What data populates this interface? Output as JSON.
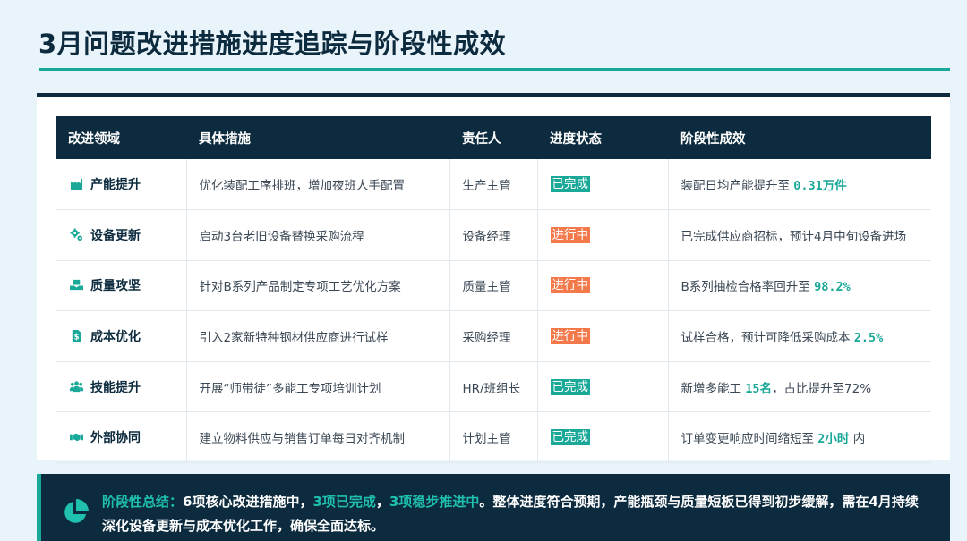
{
  "page": {
    "title": "3月问题改进措施进度追踪与阶段性成效"
  },
  "table": {
    "headers": [
      "改进领域",
      "具体措施",
      "责任人",
      "进度状态",
      "阶段性成效"
    ],
    "rows": [
      {
        "area": "产能提升",
        "icon": "factory-icon",
        "measure": "优化装配工序排班，增加夜班人手配置",
        "owner": "生产主管",
        "status": "已完成",
        "status_type": "done",
        "result_pre": "装配日均产能提升至 ",
        "result_hl": "0.31万件",
        "result_post": ""
      },
      {
        "area": "设备更新",
        "icon": "gears-icon",
        "measure": "启动3台老旧设备替换采购流程",
        "owner": "设备经理",
        "status": "进行中",
        "status_type": "doing",
        "result_pre": "已完成供应商招标，预计4月中旬设备进场",
        "result_hl": "",
        "result_post": ""
      },
      {
        "area": "质量攻坚",
        "icon": "hands-box-icon",
        "measure": "针对B系列产品制定专项工艺优化方案",
        "owner": "质量主管",
        "status": "进行中",
        "status_type": "doing",
        "result_pre": "B系列抽检合格率回升至 ",
        "result_hl": "98.2%",
        "result_post": ""
      },
      {
        "area": "成本优化",
        "icon": "dollar-file-icon",
        "measure": "引入2家新特种钢材供应商进行试样",
        "owner": "采购经理",
        "status": "进行中",
        "status_type": "doing",
        "result_pre": "试样合格，预计可降低采购成本 ",
        "result_hl": "2.5%",
        "result_post": ""
      },
      {
        "area": "技能提升",
        "icon": "users-icon",
        "measure": "开展“师带徒”多能工专项培训计划",
        "owner": "HR/班组长",
        "status": "已完成",
        "status_type": "done",
        "result_pre": "新增多能工 ",
        "result_hl": "15名",
        "result_post": "，占比提升至72%"
      },
      {
        "area": "外部协同",
        "icon": "handshake-icon",
        "measure": "建立物料供应与销售订单每日对齐机制",
        "owner": "计划主管",
        "status": "已完成",
        "status_type": "done",
        "result_pre": "订单变更响应时间缩短至 ",
        "result_hl": "2小时",
        "result_post": " 内"
      }
    ]
  },
  "summary": {
    "icon": "pie-chart-icon",
    "label": "阶段性总结：",
    "t1": "6项核心改进措施中，",
    "h1": "3项已完成",
    "t2": "，",
    "h2": "3项稳步推进中",
    "t3": "。整体进度符合预期，产能瓶颈与质量短板已得到初步缓解，需在4月持续深化设备更新与成本优化工作，确保全面达标。"
  },
  "colors": {
    "primary": "#0d2b3e",
    "accent": "#1aa898",
    "doing": "#f3784a"
  }
}
